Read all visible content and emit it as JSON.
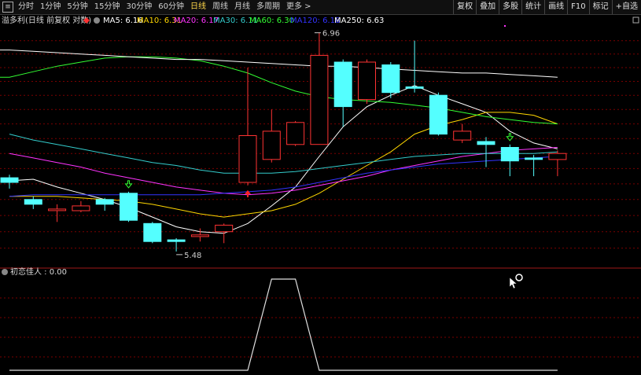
{
  "toolbar": {
    "periods": [
      {
        "label": "分时",
        "active": false
      },
      {
        "label": "1分钟",
        "active": false
      },
      {
        "label": "5分钟",
        "active": false
      },
      {
        "label": "15分钟",
        "active": false
      },
      {
        "label": "30分钟",
        "active": false
      },
      {
        "label": "60分钟",
        "active": false
      },
      {
        "label": "日线",
        "active": true
      },
      {
        "label": "周线",
        "active": false
      },
      {
        "label": "月线",
        "active": false
      },
      {
        "label": "多周期",
        "active": false
      },
      {
        "label": "更多 >",
        "active": false
      }
    ],
    "right_buttons": [
      "复权",
      "叠加",
      "多股",
      "统计",
      "画线",
      "F10",
      "标记",
      "+自选"
    ]
  },
  "main_panel": {
    "title": "溢多利(日线 前复权 对数)",
    "ma_labels": [
      {
        "text": "MA5: 6.16",
        "color": "#ffffff"
      },
      {
        "text": "MA10: 6.31",
        "color": "#ffd700"
      },
      {
        "text": "MA20: 6.17",
        "color": "#ff33ff"
      },
      {
        "text": "MA30: 6.11",
        "color": "#33cccc"
      },
      {
        "text": "MA60: 6.30",
        "color": "#33ff33"
      },
      {
        "text": "MA120: 6.18",
        "color": "#3333ff"
      },
      {
        "text": "MA250: 6.63",
        "color": "#ffffff"
      }
    ],
    "high_label": "6.96",
    "low_label": "5.48"
  },
  "indicator_panel": {
    "label": "初恋佳人 : 0.00"
  },
  "colors": {
    "up": "#ff3333",
    "down": "#54ffff",
    "grid": "#7a0000",
    "panel_border": "#a01818"
  },
  "chart_data": {
    "type": "candlestick",
    "candles": [
      {
        "o": 5.94,
        "c": 5.91,
        "h": 5.96,
        "l": 5.87
      },
      {
        "o": 5.8,
        "c": 5.77,
        "h": 5.82,
        "l": 5.74
      },
      {
        "o": 5.73,
        "c": 5.74,
        "h": 5.77,
        "l": 5.66
      },
      {
        "o": 5.73,
        "c": 5.76,
        "h": 5.79,
        "l": 5.72
      },
      {
        "o": 5.8,
        "c": 5.77,
        "h": 5.81,
        "l": 5.73
      },
      {
        "o": 5.84,
        "c": 5.67,
        "h": 5.85,
        "l": 5.66
      },
      {
        "o": 5.65,
        "c": 5.54,
        "h": 5.66,
        "l": 5.53
      },
      {
        "o": 5.55,
        "c": 5.54,
        "h": 5.56,
        "l": 5.48
      },
      {
        "o": 5.57,
        "c": 5.58,
        "h": 5.62,
        "l": 5.54
      },
      {
        "o": 5.6,
        "c": 5.64,
        "h": 5.65,
        "l": 5.53
      },
      {
        "o": 5.91,
        "c": 6.22,
        "h": 6.7,
        "l": 5.89
      },
      {
        "o": 6.06,
        "c": 6.25,
        "h": 6.4,
        "l": 6.04
      },
      {
        "o": 6.16,
        "c": 6.31,
        "h": 6.32,
        "l": 6.15
      },
      {
        "o": 6.16,
        "c": 6.79,
        "h": 6.96,
        "l": 6.16
      },
      {
        "o": 6.74,
        "c": 6.42,
        "h": 6.76,
        "l": 6.28
      },
      {
        "o": 6.47,
        "c": 6.74,
        "h": 6.76,
        "l": 6.44
      },
      {
        "o": 6.72,
        "c": 6.52,
        "h": 6.74,
        "l": 6.48
      },
      {
        "o": 6.56,
        "c": 6.55,
        "h": 6.9,
        "l": 6.52
      },
      {
        "o": 6.5,
        "c": 6.23,
        "h": 6.52,
        "l": 6.22
      },
      {
        "o": 6.19,
        "c": 6.25,
        "h": 6.3,
        "l": 6.17
      },
      {
        "o": 6.18,
        "c": 6.16,
        "h": 6.21,
        "l": 6.01
      },
      {
        "o": 6.14,
        "c": 6.05,
        "h": 6.16,
        "l": 5.95
      },
      {
        "o": 6.07,
        "c": 6.06,
        "h": 6.09,
        "l": 5.95
      },
      {
        "o": 6.06,
        "c": 6.1,
        "h": 6.12,
        "l": 5.95
      }
    ],
    "ma": [
      {
        "name": "MA5",
        "color": "#ffffff",
        "values": [
          5.92,
          5.93,
          5.88,
          5.84,
          5.8,
          5.75,
          5.69,
          5.63,
          5.6,
          5.59,
          5.65,
          5.76,
          5.88,
          6.08,
          6.28,
          6.42,
          6.5,
          6.57,
          6.5,
          6.44,
          6.38,
          6.25,
          6.17,
          6.13
        ]
      },
      {
        "name": "MA10",
        "color": "#ffd700",
        "values": [
          5.82,
          5.82,
          5.82,
          5.81,
          5.8,
          5.79,
          5.77,
          5.74,
          5.71,
          5.69,
          5.71,
          5.73,
          5.77,
          5.84,
          5.93,
          6.02,
          6.11,
          6.23,
          6.29,
          6.33,
          6.38,
          6.38,
          6.36,
          6.3
        ]
      },
      {
        "name": "MA20",
        "color": "#ff33ff",
        "values": [
          6.1,
          6.07,
          6.04,
          6.01,
          5.97,
          5.94,
          5.91,
          5.88,
          5.86,
          5.84,
          5.83,
          5.84,
          5.86,
          5.89,
          5.92,
          5.95,
          5.99,
          6.02,
          6.05,
          6.08,
          6.1,
          6.12,
          6.13,
          6.14
        ]
      },
      {
        "name": "MA30",
        "color": "#33cccc",
        "values": [
          6.23,
          6.19,
          6.16,
          6.13,
          6.1,
          6.07,
          6.04,
          6.02,
          5.99,
          5.97,
          5.97,
          5.97,
          5.98,
          6.0,
          6.02,
          6.04,
          6.06,
          6.08,
          6.09,
          6.1,
          6.1,
          6.1,
          6.1,
          6.11
        ]
      },
      {
        "name": "MA60",
        "color": "#33ff33",
        "values": [
          6.63,
          6.67,
          6.71,
          6.74,
          6.77,
          6.78,
          6.78,
          6.77,
          6.75,
          6.71,
          6.66,
          6.59,
          6.53,
          6.49,
          6.47,
          6.46,
          6.45,
          6.43,
          6.41,
          6.38,
          6.35,
          6.33,
          6.31,
          6.3
        ]
      },
      {
        "name": "MA120",
        "color": "#3333ff",
        "values": [
          5.82,
          5.83,
          5.83,
          5.83,
          5.83,
          5.83,
          5.83,
          5.83,
          5.83,
          5.84,
          5.85,
          5.86,
          5.88,
          5.91,
          5.94,
          5.97,
          5.99,
          6.01,
          6.03,
          6.04,
          6.05,
          6.06,
          6.07,
          6.08
        ]
      },
      {
        "name": "MA250",
        "color": "#ffffff",
        "values": [
          6.83,
          6.82,
          6.81,
          6.8,
          6.79,
          6.78,
          6.77,
          6.76,
          6.76,
          6.75,
          6.74,
          6.73,
          6.72,
          6.71,
          6.71,
          6.7,
          6.69,
          6.68,
          6.67,
          6.66,
          6.66,
          6.65,
          6.64,
          6.63
        ]
      }
    ],
    "signal_up_candles": [
      10
    ],
    "signal_down_candles": [
      5,
      21
    ],
    "indicator": {
      "name": "初恋佳人",
      "values": [
        0,
        0,
        0,
        0,
        0,
        0,
        0,
        0,
        0,
        0,
        0,
        1,
        1,
        0,
        0,
        0,
        0,
        0,
        0,
        0,
        0,
        0,
        0,
        0
      ]
    }
  }
}
